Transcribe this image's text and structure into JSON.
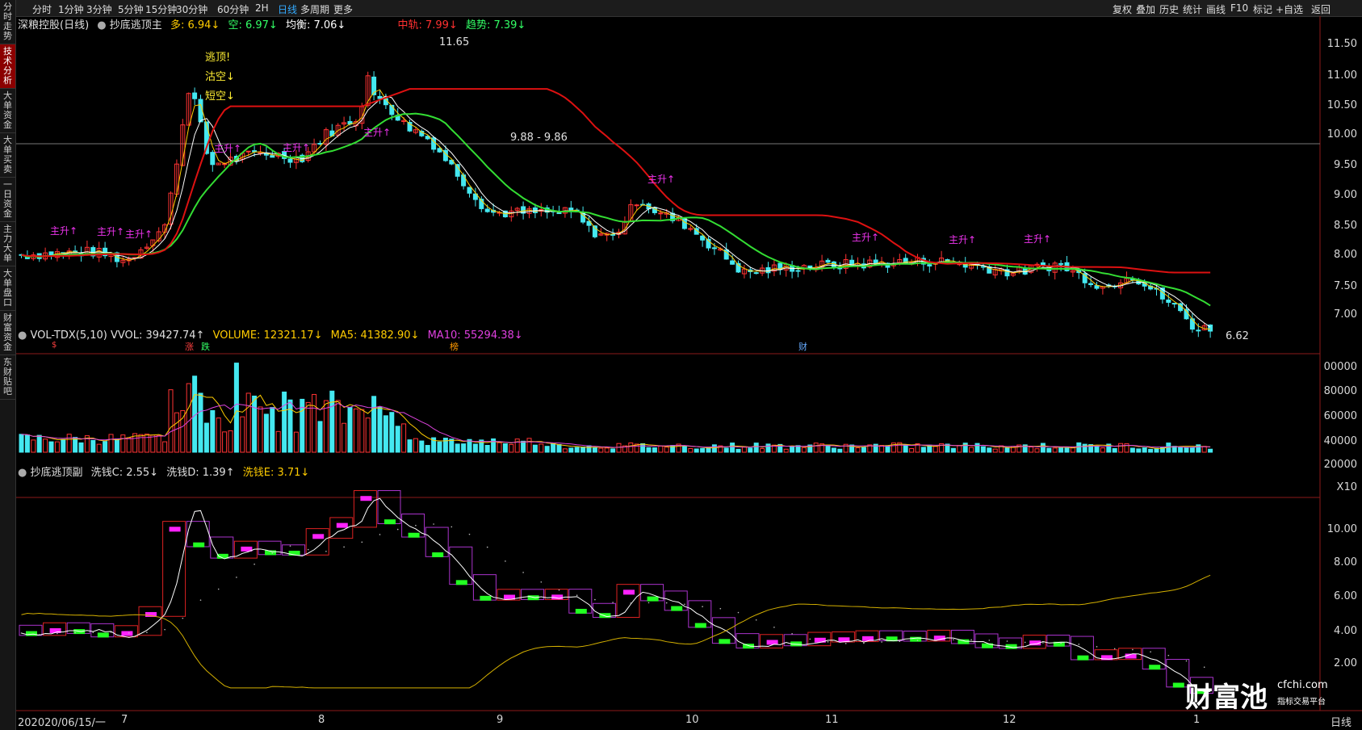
{
  "sidebar": [
    {
      "label": "分时走势",
      "active": false
    },
    {
      "label": "技术分析",
      "active": true
    },
    {
      "label": "大单资金",
      "active": false
    },
    {
      "label": "大单买卖",
      "active": false
    },
    {
      "label": "一日资金",
      "active": false
    },
    {
      "label": "主力大单",
      "active": false
    },
    {
      "label": "大单盘口",
      "active": false
    },
    {
      "label": "财富资金",
      "active": false
    },
    {
      "label": "东财贴吧",
      "active": false
    }
  ],
  "periods": [
    "分时",
    "1分钟",
    "3分钟",
    "5分钟",
    "15分钟",
    "30分钟",
    "60分钟",
    "2H",
    "日线",
    "多周期",
    "更多"
  ],
  "active_period": "日线",
  "toolbar_right": [
    "复权",
    "叠加",
    "历史",
    "统计",
    "画线",
    "F10",
    "标记",
    "+自选",
    "返回"
  ],
  "main_legend": {
    "title": "深粮控股(日线)",
    "indicator": "抄底逃顶主",
    "duo": "多: 6.94↓",
    "kong": "空: 6.97↓",
    "junheng": "均衡: 7.06↓",
    "zhonggui": "中轨: 7.99↓",
    "qushi": "趋势: 7.39↓"
  },
  "vol_legend": {
    "name": "VOL-TDX(5,10)",
    "vvol": "VVOL: 39427.74↑",
    "volume": "VOLUME: 12321.17↓",
    "ma5": "MA5: 41382.90↓",
    "ma10": "MA10: 55294.38↓"
  },
  "sub_legend": {
    "name": "抄底逃顶副",
    "c": "洗钱C: 2.55↓",
    "d": "洗钱D: 1.39↑",
    "e": "洗钱E: 3.71↓"
  },
  "annotations": {
    "high_label": "11.65",
    "low_label": "6.62",
    "line_label": "9.88 - 9.86",
    "escape_top": "逃顶!",
    "sell_short": "沽空↓",
    "short_short": "短空↓",
    "up": "主升↑",
    "event_zhang": "涨",
    "event_die": "跌",
    "event_bang": "榜",
    "event_cai": "财",
    "event_s": "$"
  },
  "price_axis": [
    "11.50",
    "11.00",
    "10.50",
    "10.00",
    "9.50",
    "9.00",
    "8.50",
    "8.00",
    "7.50",
    "7.00"
  ],
  "vol_axis": [
    "00000",
    "80000",
    "60000",
    "40000",
    "20000",
    "X10"
  ],
  "sub_axis": [
    "10.00",
    "8.00",
    "6.00",
    "4.00",
    "2.00"
  ],
  "x_axis": {
    "start": "2020/06/15/一",
    "months": [
      "7",
      "8",
      "9",
      "10",
      "11",
      "12",
      "1"
    ],
    "left_cut": "20",
    "period_label": "日线"
  },
  "watermark": {
    "brand": "财富池",
    "domain": "cfchi.com",
    "slogan": "指标交易平台"
  },
  "chart_data": [
    {
      "type": "candlestick",
      "title": "深粮控股(日线)",
      "ylim": [
        6.5,
        11.8
      ],
      "markers": {
        "high": 11.65,
        "low": 6.62,
        "hline": 9.87
      },
      "series": [
        {
          "name": "中轨",
          "last": 7.99
        },
        {
          "name": "趋势",
          "last": 7.39
        },
        {
          "name": "均衡",
          "last": 7.06
        },
        {
          "name": "多",
          "last": 6.94
        },
        {
          "name": "空",
          "last": 6.97
        }
      ]
    },
    {
      "type": "bar",
      "title": "VOL-TDX(5,10)",
      "ylim": [
        0,
        100000
      ],
      "series": [
        {
          "name": "VOLUME",
          "last": 12321.17
        },
        {
          "name": "MA5",
          "last": 41382.9
        },
        {
          "name": "MA10",
          "last": 55294.38
        }
      ]
    },
    {
      "type": "line",
      "title": "抄底逃顶副",
      "ylim": [
        0,
        11.5
      ],
      "series": [
        {
          "name": "洗钱C",
          "last": 2.55
        },
        {
          "name": "洗钱D",
          "last": 1.39
        },
        {
          "name": "洗钱E",
          "last": 3.71
        }
      ]
    }
  ]
}
